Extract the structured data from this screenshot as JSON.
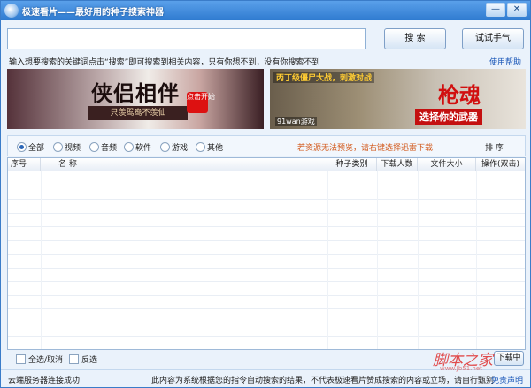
{
  "window": {
    "title": "极速看片——最好用的种子搜索神器",
    "minimize_symbol": "—",
    "close_symbol": "✕"
  },
  "search": {
    "value": "",
    "placeholder": "",
    "search_label": "搜 索",
    "try_luck_label": "试试手气"
  },
  "hint": "输入想要搜索的关键词点击“搜索”即可搜索到相关内容，只有你想不到，没有你搜索不到",
  "help_link": "使用帮助",
  "banners": {
    "left": {
      "title": "侠侣相伴",
      "subtitle": "只羡鸳鸯不羡仙",
      "badge": "点击开始"
    },
    "right": {
      "top_text": "丙丁级僵尸大战，刺激对战",
      "title": "枪魂",
      "slogan": "选择你的武器",
      "logo": "91wan游戏"
    }
  },
  "filters": {
    "options": [
      {
        "label": "全部",
        "selected": true
      },
      {
        "label": "视频",
        "selected": false
      },
      {
        "label": "音频",
        "selected": false
      },
      {
        "label": "软件",
        "selected": false
      },
      {
        "label": "游戏",
        "selected": false
      },
      {
        "label": "其他",
        "selected": false
      }
    ],
    "preview_tip": "若资源无法预览，请右键选择迅雷下载",
    "sort_label": "排 序"
  },
  "table": {
    "columns": [
      "序号",
      "名 称",
      "种子类别",
      "下载人数",
      "文件大小",
      "操作(双击)"
    ],
    "rows": []
  },
  "bottom": {
    "select_all_label": "全选/取消",
    "invert_label": "反选",
    "download_label": "下载中"
  },
  "status": {
    "connection": "云端服务器连接成功",
    "disclaimer": "此内容为系统根据您的指令自动搜索的结果，不代表极速看片赞成搜索的内容或立场，请自行甄别",
    "disclaimer_link": "免责声明"
  },
  "watermark": {
    "text": "脚本之家",
    "url": "www.Jb51.net"
  }
}
